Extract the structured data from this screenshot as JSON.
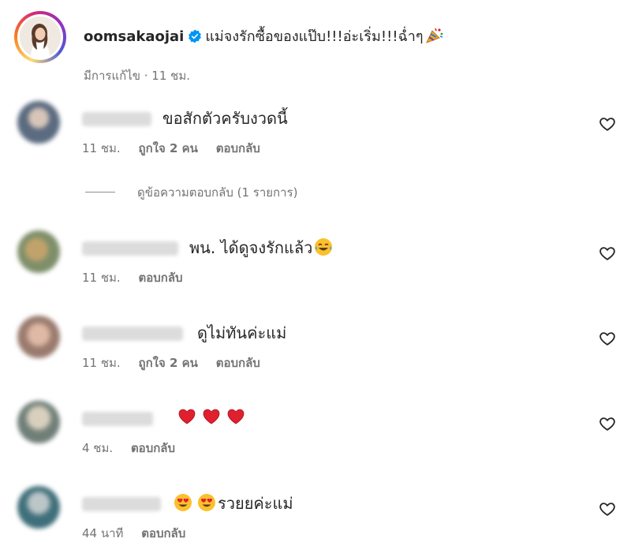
{
  "caption": {
    "username": "oomsakaojai",
    "text": "แม่จงรักซื้อของแป๊บ!!!อ่ะเริ่ม!!!ฉ่ำๆ",
    "meta": "มีการแก้ไข · 11 ชม.",
    "verified_color": "#0095f6",
    "icon": "party-popper-icon"
  },
  "comments": [
    {
      "text": "ขอสักตัวครับงวดนี้",
      "time": "11 ชม.",
      "likes": "ถูกใจ 2 คน",
      "reply": "ตอบกลับ"
    },
    {
      "text": "พน. ได้ดูจงรักแล้ว",
      "time": "11 ชม.",
      "reply": "ตอบกลับ",
      "emoji": "tears-of-joy-emoji"
    },
    {
      "text": "ดูไม่ทันค่ะแม่",
      "time": "11 ชม.",
      "likes": "ถูกใจ 2 คน",
      "reply": "ตอบกลับ"
    },
    {
      "text": "",
      "time": "4 ชม.",
      "reply": "ตอบกลับ",
      "emoji": "red-heart-emoji-x3"
    },
    {
      "text": "รวยยค่ะแม่",
      "time": "44 นาที",
      "reply": "ตอบกลับ",
      "emoji": "heart-eyes-emoji-x2"
    }
  ],
  "view_replies": "ดูข้อความตอบกลับ (1 รายการ)",
  "colors": {
    "text": "#262626",
    "secondary": "#737373",
    "heart_red": "#e0202e",
    "emoji_yellow": "#fbc02d"
  }
}
